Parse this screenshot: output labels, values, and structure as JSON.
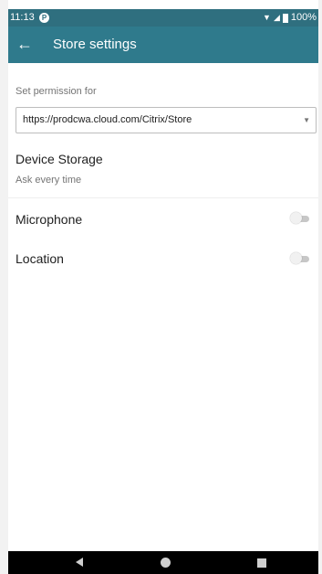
{
  "status_bar": {
    "time": "11:13",
    "notification_icon": "circle-p-icon",
    "battery_text": "100%",
    "wifi_icon": "wifi-icon",
    "signal_icon": "signal-icon",
    "battery_icon": "battery-icon"
  },
  "app_bar": {
    "back_icon": "arrow-left-icon",
    "title": "Store settings",
    "color": "#2f7a8c"
  },
  "permission": {
    "label": "Set permission for",
    "selected_url": "https://prodcwa.cloud.com/Citrix/Store"
  },
  "device_storage": {
    "title": "Device Storage",
    "subtitle": "Ask every time"
  },
  "toggles": [
    {
      "label": "Microphone",
      "enabled": false
    },
    {
      "label": "Location",
      "enabled": false
    }
  ],
  "nav_bar": {
    "back_icon": "triangle-back-icon",
    "home_icon": "circle-home-icon",
    "recents_icon": "square-recents-icon"
  }
}
